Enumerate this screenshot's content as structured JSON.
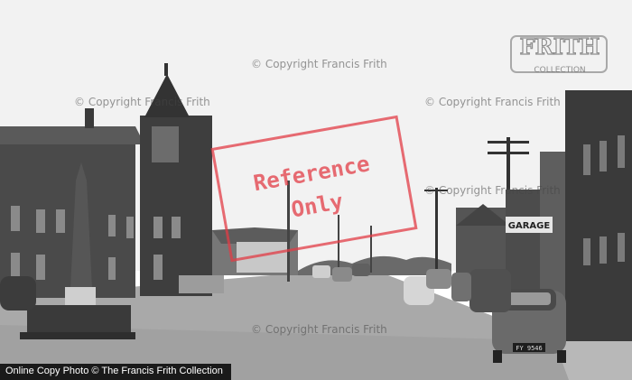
{
  "watermarks": {
    "copyright_1": "© Copyright Francis Frith",
    "copyright_2": "© Copyright Francis Frith",
    "copyright_3": "© Copyright Francis Frith",
    "copyright_4": "© Copyright Francis Frith",
    "copyright_5": "© Copyright Francis Frith"
  },
  "stamp": {
    "line1": "Reference",
    "line2": "Only"
  },
  "logo": {
    "text_top": "FRITH",
    "text_bottom": "COLLECTION"
  },
  "signs": {
    "garage": "GARAGE",
    "number_plate": "FY 9546"
  },
  "footer": {
    "text": "Online Copy Photo © The Francis Frith Collection"
  },
  "colors": {
    "stamp": "#e13c46",
    "footer_bg": "#1a1a1a"
  }
}
